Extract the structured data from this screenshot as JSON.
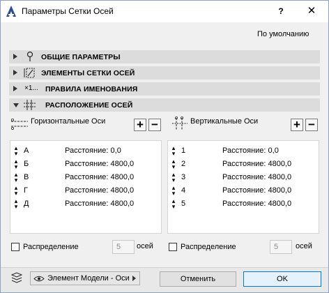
{
  "window": {
    "title": "Параметры Сетки Осей",
    "help_label": "?",
    "close_label": "✕"
  },
  "default_button": "По умолчанию",
  "sections": [
    {
      "label": "ОБЩИЕ ПАРАМЕТРЫ",
      "expanded": false,
      "icon": "pin-icon"
    },
    {
      "label": "ЭЛЕМЕНТЫ СЕТКИ ОСЕЙ",
      "expanded": false,
      "icon": "grid-element-icon"
    },
    {
      "label": "ПРАВИЛА ИМЕНОВАНИЯ",
      "expanded": false,
      "icon": "naming-icon",
      "icon_text": "×1..."
    },
    {
      "label": "РАСПОЛОЖЕНИЕ ОСЕЙ",
      "expanded": true,
      "icon": "grid-layout-icon"
    }
  ],
  "horizontal": {
    "label": "Горизонтальные Оси",
    "add_label": "+",
    "remove_label": "−",
    "rows": [
      {
        "name": "А",
        "distance": "Расстояние: 0,0"
      },
      {
        "name": "Б",
        "distance": "Расстояние: 4800,0"
      },
      {
        "name": "В",
        "distance": "Расстояние: 4800,0"
      },
      {
        "name": "Г",
        "distance": "Расстояние: 4800,0"
      },
      {
        "name": "Д",
        "distance": "Расстояние: 4800,0"
      }
    ],
    "distribution_label": "Распределение",
    "distribution_checked": false,
    "count": "5",
    "count_unit": "осей"
  },
  "vertical": {
    "label": "Вертикальные Оси",
    "add_label": "+",
    "remove_label": "−",
    "rows": [
      {
        "name": "1",
        "distance": "Расстояние: 0,0"
      },
      {
        "name": "2",
        "distance": "Расстояние: 4800,0"
      },
      {
        "name": "3",
        "distance": "Расстояние: 4800,0"
      },
      {
        "name": "4",
        "distance": "Расстояние: 4800,0"
      },
      {
        "name": "5",
        "distance": "Расстояние: 4800,0"
      }
    ],
    "distribution_label": "Распределение",
    "distribution_checked": false,
    "count": "5",
    "count_unit": "осей"
  },
  "footer": {
    "layer_dropdown": "Элемент Модели - Оси",
    "cancel_label": "Отменить",
    "ok_label": "OK"
  },
  "colors": {
    "ok_border": "#0078d7",
    "section_bg": "#dcdcdc",
    "dialog_bg": "#f0f0f0"
  }
}
